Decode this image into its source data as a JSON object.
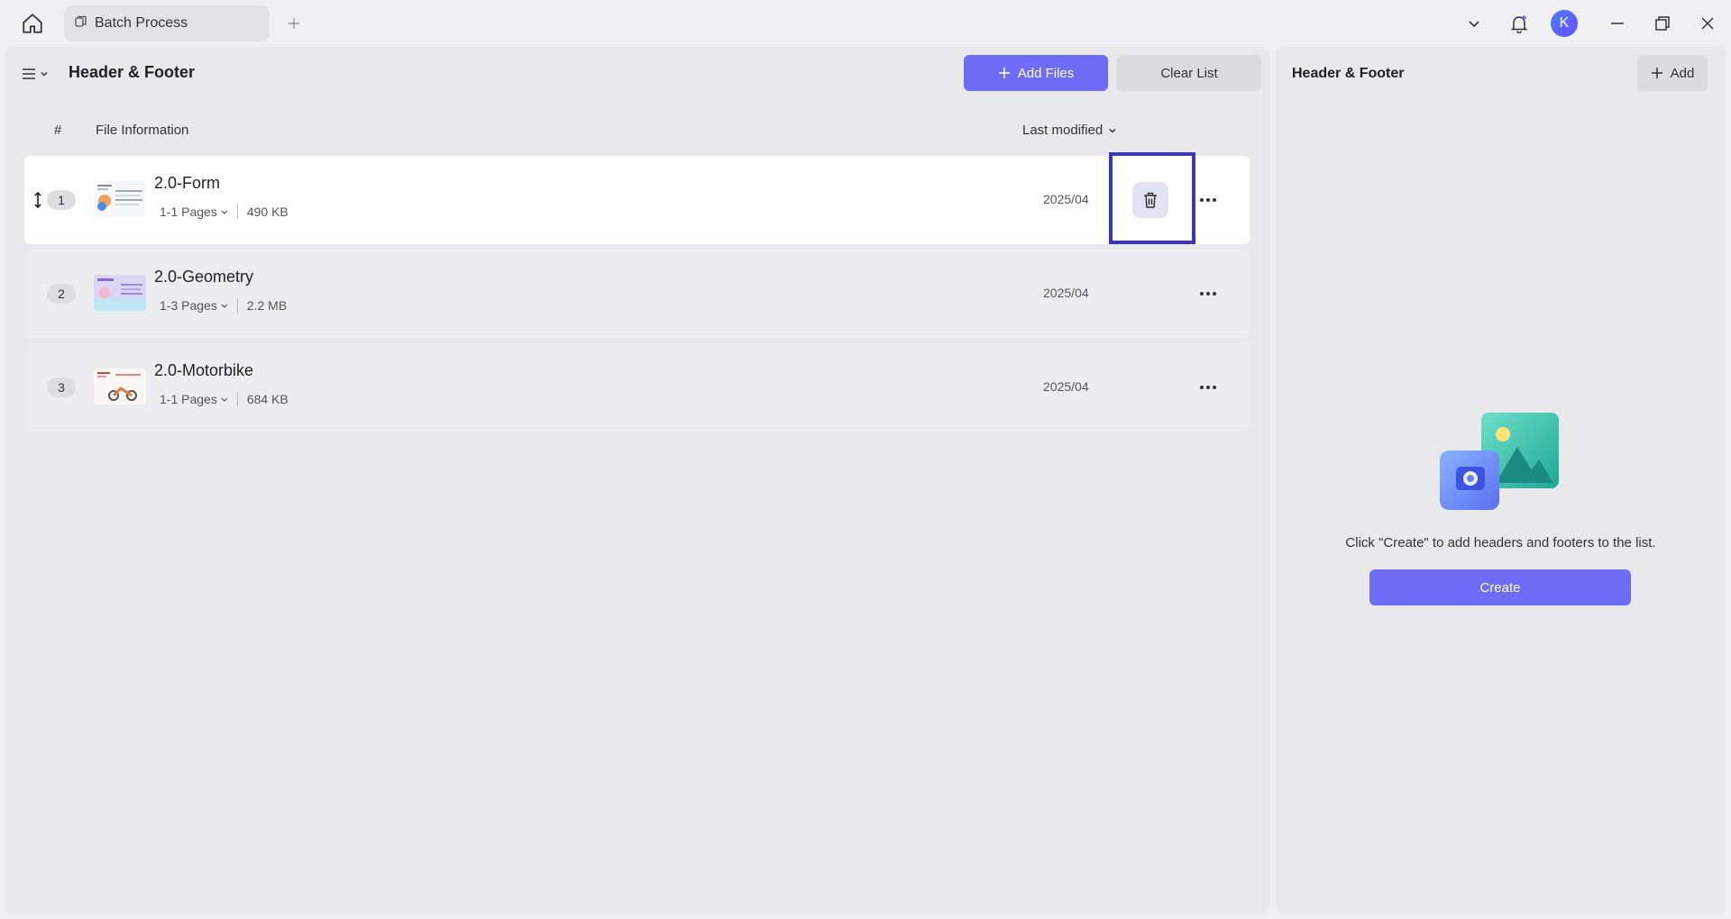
{
  "tabs": [
    {
      "label": "Batch Process"
    }
  ],
  "user": {
    "avatar_letter": "K"
  },
  "main": {
    "title": "Header & Footer",
    "add_files_label": "Add Files",
    "clear_list_label": "Clear List",
    "columns": {
      "index": "#",
      "info": "File Information",
      "sort": "Last modified"
    },
    "files": [
      {
        "index": "1",
        "name": "2.0-Form",
        "pages": "1-1 Pages",
        "size": "490 KB",
        "date": "2025/04",
        "active": true
      },
      {
        "index": "2",
        "name": "2.0-Geometry",
        "pages": "1-3 Pages",
        "size": "2.2 MB",
        "date": "2025/04",
        "active": false
      },
      {
        "index": "3",
        "name": "2.0-Motorbike",
        "pages": "1-1 Pages",
        "size": "684 KB",
        "date": "2025/04",
        "active": false
      }
    ]
  },
  "side": {
    "title": "Header & Footer",
    "add_label": "Add",
    "empty_text": "Click \"Create\" to add headers and footers to the list.",
    "create_label": "Create"
  },
  "colors": {
    "accent": "#6e6cf5",
    "highlight": "#3b35c0"
  }
}
